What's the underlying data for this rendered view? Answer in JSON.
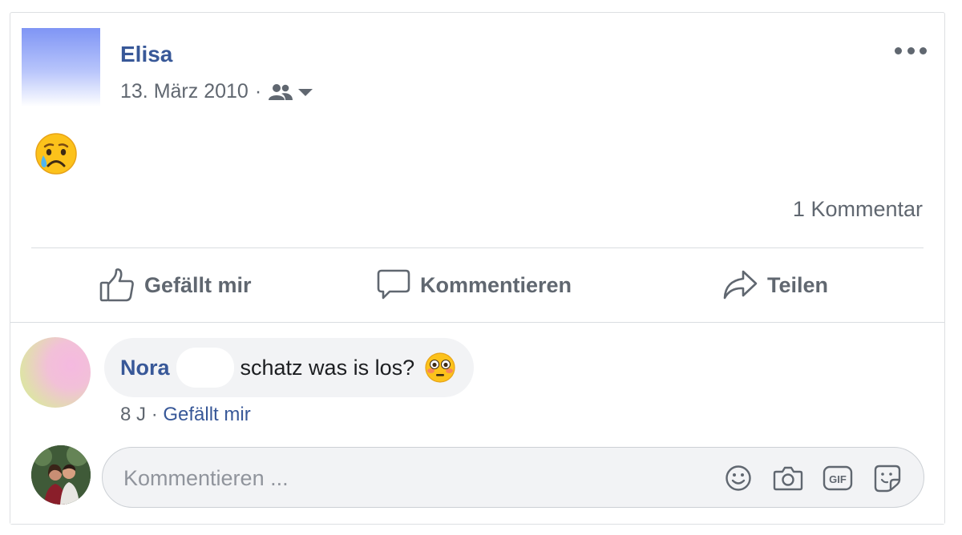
{
  "post": {
    "author": "Elisa",
    "date": "13. März 2010",
    "separator": "·",
    "audience_icon": "friends-icon",
    "body_emoji": "crying-face",
    "comment_count": "1 Kommentar"
  },
  "actions": {
    "like": "Gefällt mir",
    "comment": "Kommentieren",
    "share": "Teilen"
  },
  "comment": {
    "author": "Nora",
    "text": "schatz was is los?",
    "emoji": "flushed-face",
    "age": "8 J",
    "separator": "·",
    "like_label": "Gefällt mir"
  },
  "composer": {
    "placeholder": "Kommentieren ...",
    "tools": [
      "emoji-icon",
      "camera-icon",
      "gif-icon",
      "sticker-icon"
    ]
  },
  "colors": {
    "link": "#385898",
    "meta": "#606770",
    "bubble": "#f2f3f5"
  }
}
